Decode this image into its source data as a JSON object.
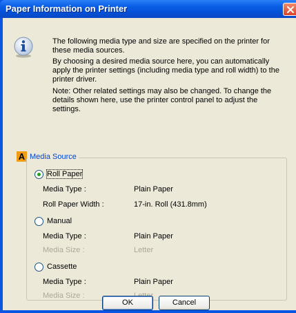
{
  "window": {
    "title": "Paper Information on Printer"
  },
  "intro": {
    "p1": "The following media type and size are specified on the printer for these media sources.",
    "p2": "By choosing a desired media source here, you can automatically apply the printer settings (including media type and roll width) to the printer driver.",
    "p3": "Note: Other related settings may also be changed. To change the details shown here, use the printer control panel to adjust the settings."
  },
  "section": {
    "badge": "A",
    "title": "Media Source"
  },
  "sources": {
    "roll": {
      "label": "Roll Paper",
      "selected": true,
      "type_label": "Media Type :",
      "type_value": "Plain Paper",
      "width_label": "Roll Paper Width :",
      "width_value": "17-in. Roll (431.8mm)"
    },
    "manual": {
      "label": "Manual",
      "selected": false,
      "type_label": "Media Type :",
      "type_value": "Plain Paper",
      "size_label": "Media Size :",
      "size_value": "Letter"
    },
    "cassette": {
      "label": "Cassette",
      "selected": false,
      "type_label": "Media Type :",
      "type_value": "Plain Paper",
      "size_label": "Media Size :",
      "size_value": "Letter"
    }
  },
  "buttons": {
    "ok": "OK",
    "cancel": "Cancel"
  },
  "icons": {
    "info": "info-icon",
    "close": "close-icon"
  },
  "colors": {
    "titlebar": "#0a5fe6",
    "accent_text": "#0046d5",
    "badge": "#f39c12",
    "radio_dot": "#21a121"
  }
}
